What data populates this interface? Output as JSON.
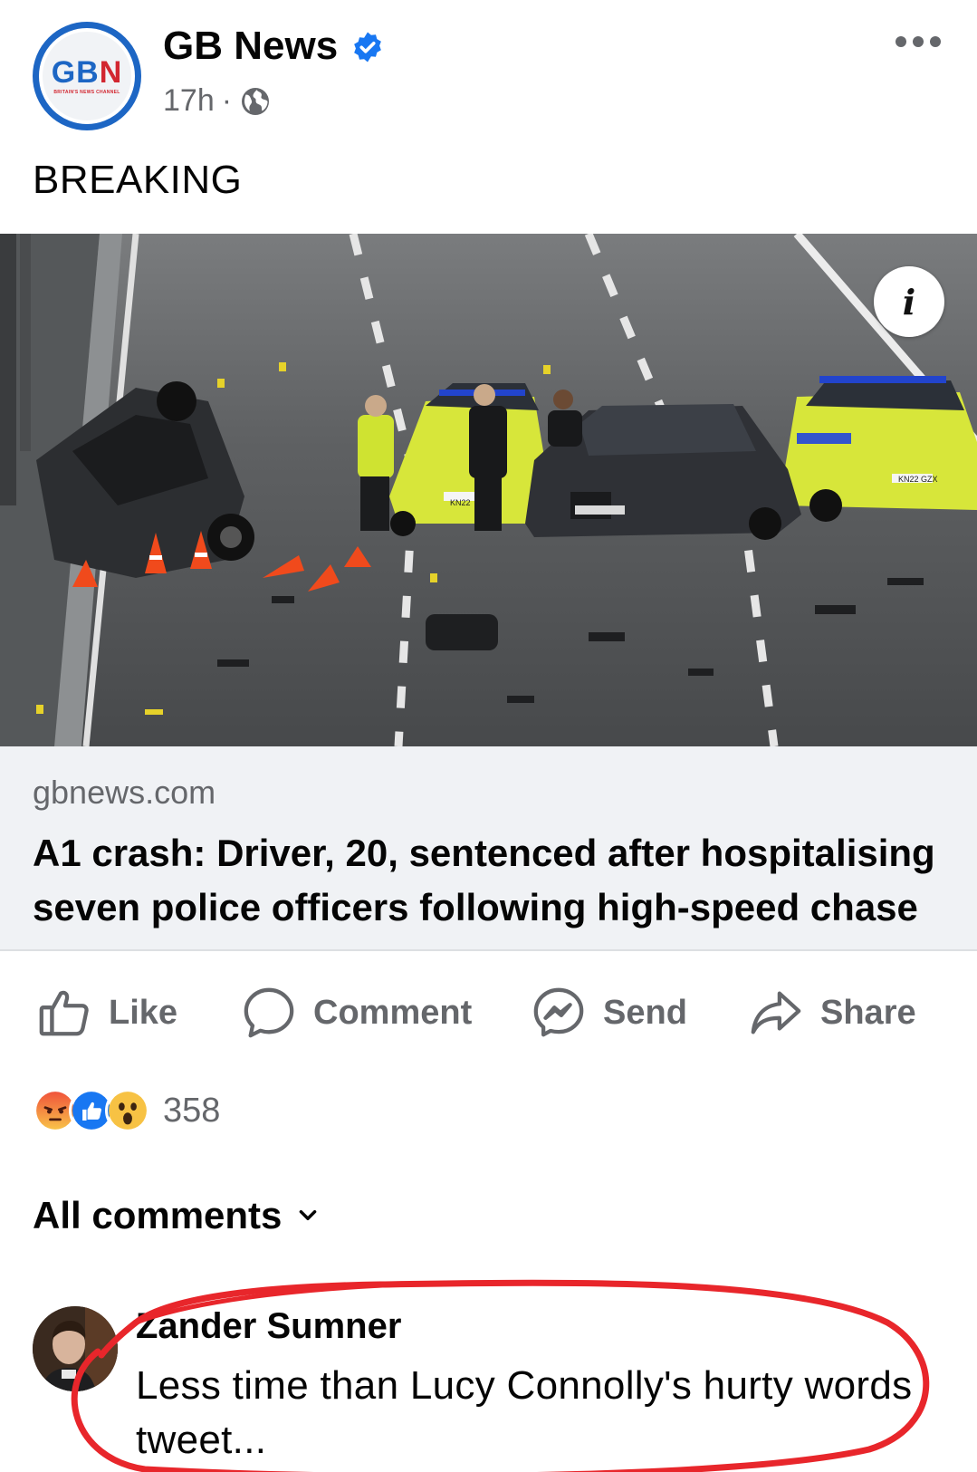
{
  "post": {
    "page_name": "GB News",
    "logo_text_blue": "GB",
    "logo_text_red": "N",
    "logo_subtitle": "BRITAIN'S NEWS CHANNEL",
    "time": "17h",
    "separator": "·",
    "audience_icon": "globe-icon",
    "verified_icon": "verified-badge-icon",
    "more_icon": "more-options-icon",
    "text": "BREAKING"
  },
  "link": {
    "domain": "gbnews.com",
    "title": "A1 crash: Driver, 20, sentenced after hospitalising seven police officers following high-speed chase",
    "info_label": "i",
    "plates": [
      "KN22",
      "KN22 GZX"
    ]
  },
  "actions": [
    {
      "label": "Like",
      "icon": "thumbs-up-icon"
    },
    {
      "label": "Comment",
      "icon": "comment-bubble-icon"
    },
    {
      "label": "Send",
      "icon": "messenger-icon"
    },
    {
      "label": "Share",
      "icon": "share-arrow-icon"
    }
  ],
  "reactions": {
    "icons": [
      "angry-reaction-icon",
      "like-reaction-icon",
      "wow-reaction-icon"
    ],
    "count": "358"
  },
  "comments_filter": {
    "label": "All comments",
    "icon": "chevron-down-icon"
  },
  "comment": {
    "author": "Zander Sumner",
    "text": "Less time than Lucy Connolly's hurty words tweet..."
  },
  "colors": {
    "brand_blue": "#1d66c4",
    "brand_red": "#d22630",
    "secondary_text": "#65676b",
    "annotation_red": "#e8262b",
    "police_yellow": "#d7e63a"
  }
}
